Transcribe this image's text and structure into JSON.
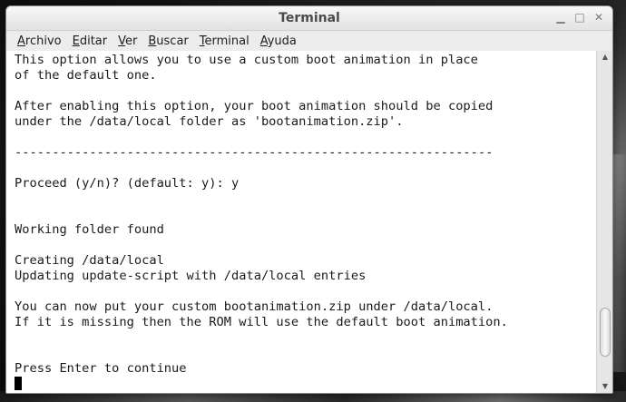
{
  "window": {
    "title": "Terminal",
    "controls": {
      "minimize": "▁",
      "maximize": "□",
      "close": "✕"
    }
  },
  "menu": [
    {
      "accel": "A",
      "rest": "rchivo"
    },
    {
      "accel": "E",
      "rest": "ditar"
    },
    {
      "accel": "V",
      "rest": "er"
    },
    {
      "accel": "B",
      "rest": "uscar"
    },
    {
      "accel": "T",
      "rest": "erminal"
    },
    {
      "accel": "A",
      "rest": "yuda"
    }
  ],
  "terminal": {
    "lines": [
      "This option allows you to use a custom boot animation in place",
      "of the default one.",
      "",
      "After enabling this option, your boot animation should be copied",
      "under the /data/local folder as 'bootanimation.zip'.",
      "",
      "----------------------------------------------------------------",
      "",
      "Proceed (y/n)? (default: y): y",
      "",
      "",
      "Working folder found",
      "",
      "Creating /data/local",
      "Updating update-script with /data/local entries",
      "",
      "You can now put your custom bootanimation.zip under /data/local.",
      "If it is missing then the ROM will use the default boot animation.",
      "",
      "",
      "Press Enter to continue"
    ]
  },
  "scrollbar": {
    "position_fraction": 0.95
  },
  "icons": {
    "up": "▲",
    "down": "▼"
  }
}
